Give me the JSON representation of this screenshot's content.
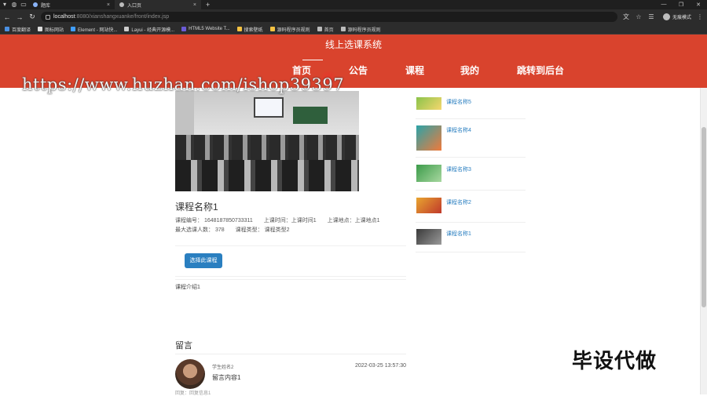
{
  "browser": {
    "tabs": [
      {
        "label": "题库"
      },
      {
        "label": "入口页"
      }
    ],
    "url_host": "localhost",
    "url_path": ":8080/xianshangxuanke/front/index.jsp",
    "profile_label": "无痕模式",
    "bookmarks": [
      "百度翻译",
      "图标网站",
      "Element - 网站快...",
      "Layui - 经典开源模...",
      "HTML5 Website T...",
      "搜索壁纸",
      "源码程序员规则",
      "首页",
      "源码程序员规则"
    ]
  },
  "site": {
    "title": "线上选课系统",
    "nav": [
      "首页",
      "公告",
      "课程",
      "我的",
      "跳转到后台"
    ],
    "active_nav": "首页"
  },
  "watermark": "https://www.huzhan.com/ishop39397",
  "course": {
    "name": "课程名称1",
    "number_label": "课程编号：",
    "number": "1648187850733311",
    "time_label": "上课时间：",
    "time": "上课时间1",
    "place_label": "上课地点：",
    "place": "上课地点1",
    "max_label": "最大选课人数：",
    "max": "378",
    "type_label": "课程类型：",
    "type": "课程类型2",
    "select_button": "选择此课程",
    "intro": "课程介绍1"
  },
  "messages": {
    "title": "留言",
    "items": [
      {
        "user": "学生姓名2",
        "time": "2022-03-25 13:57:30",
        "content": "留言内容1",
        "reply": "回复：回复信息1"
      }
    ]
  },
  "sidebar": {
    "items": [
      {
        "name": "课程名称5",
        "thumb_colors": [
          "#8bc34a",
          "#f5d76e"
        ]
      },
      {
        "name": "课程名称4",
        "thumb_colors": [
          "#2ba3a8",
          "#f07a3b"
        ]
      },
      {
        "name": "课程名称3",
        "thumb_colors": [
          "#3c9b4a",
          "#a8d8a0"
        ]
      },
      {
        "name": "课程名称2",
        "thumb_colors": [
          "#e8a530",
          "#c0392b"
        ]
      },
      {
        "name": "课程名称1",
        "thumb_colors": [
          "#3a3a3a",
          "#9a9a9a"
        ]
      }
    ]
  },
  "corner_badge": "毕设代做",
  "colors": {
    "header_red": "#d9432d",
    "link_blue": "#2a7fc0",
    "button_blue": "#2a7fc0"
  }
}
